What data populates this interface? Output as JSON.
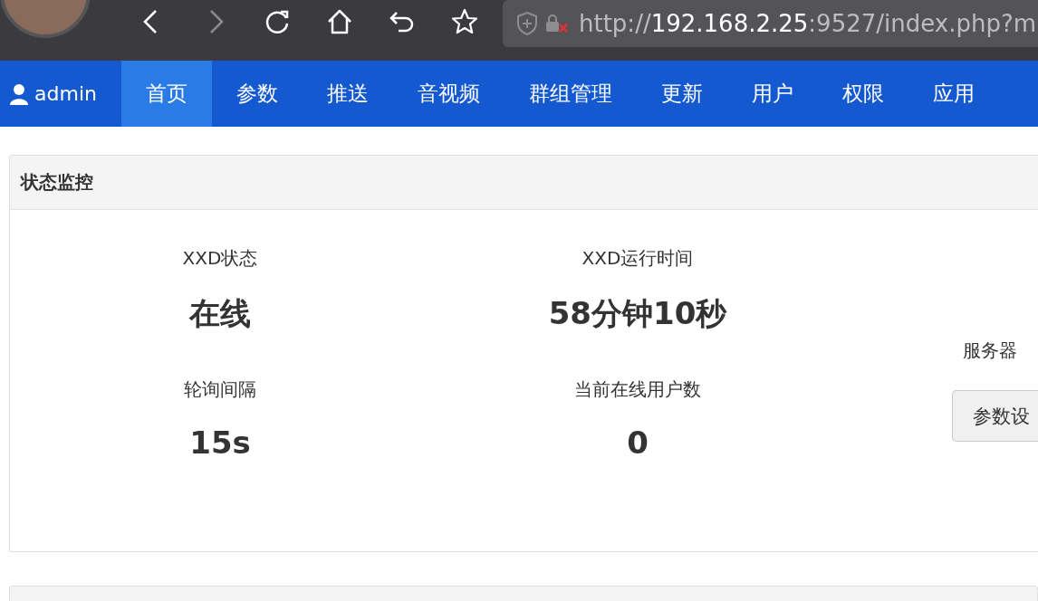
{
  "browser": {
    "toolbar": [
      {
        "kind": "back",
        "disabled": false
      },
      {
        "kind": "forward",
        "disabled": true
      },
      {
        "kind": "reload",
        "disabled": false
      },
      {
        "kind": "home",
        "disabled": false
      },
      {
        "kind": "undo",
        "disabled": false
      },
      {
        "kind": "star",
        "disabled": false
      }
    ],
    "address": {
      "scheme": "http://",
      "host": "192.168.2.25",
      "rest": ":9527/index.php?m"
    }
  },
  "nav": {
    "user": "admin",
    "tabs": [
      {
        "label": "首页",
        "selected": true
      },
      {
        "label": "参数",
        "selected": false
      },
      {
        "label": "推送",
        "selected": false
      },
      {
        "label": "音视频",
        "selected": false
      },
      {
        "label": "群组管理",
        "selected": false
      },
      {
        "label": "更新",
        "selected": false
      },
      {
        "label": "用户",
        "selected": false
      },
      {
        "label": "权限",
        "selected": false
      },
      {
        "label": "应用",
        "selected": false
      }
    ]
  },
  "panel": {
    "title": "状态监控",
    "stats": [
      {
        "label": "XXD状态",
        "value": "在线"
      },
      {
        "label": "XXD运行时间",
        "value": "58分钟10秒"
      },
      {
        "label": "轮询间隔",
        "value": "15s"
      },
      {
        "label": "当前在线用户数",
        "value": "0"
      }
    ],
    "side_label": "服务器",
    "side_button": "参数设"
  }
}
